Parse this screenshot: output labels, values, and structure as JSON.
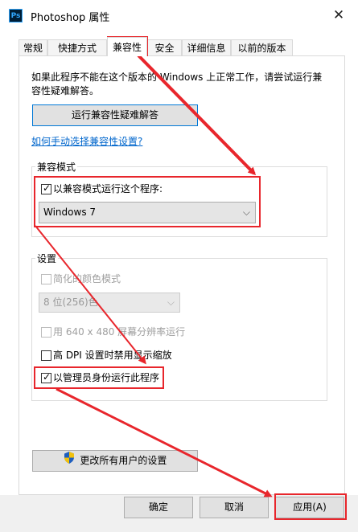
{
  "window": {
    "title": "Photoshop 属性",
    "icon_label": "Ps",
    "close_glyph": "✕"
  },
  "tabs": [
    {
      "label": "常规",
      "active": false
    },
    {
      "label": "快捷方式",
      "active": false
    },
    {
      "label": "兼容性",
      "active": true
    },
    {
      "label": "安全",
      "active": false
    },
    {
      "label": "详细信息",
      "active": false
    },
    {
      "label": "以前的版本",
      "active": false
    }
  ],
  "compat": {
    "intro_line1": "如果此程序不能在这个版本的 Windows 上正常工作，请尝试运行兼",
    "intro_line2": "容性疑难解答。",
    "troubleshooter_button": "运行兼容性疑难解答",
    "manual_link": "如何手动选择兼容性设置?",
    "mode_group_label": "兼容模式",
    "mode_checkbox_label": "以兼容模式运行这个程序:",
    "mode_checked": true,
    "mode_selected": "Windows 7",
    "settings_group_label": "设置",
    "reduced_color_label": "简化的颜色模式",
    "color_depth_selected": "8 位(256)色",
    "res_640_label": "用 640 x 480 屏幕分辨率运行",
    "high_dpi_label": "高 DPI 设置时禁用显示缩放",
    "admin_label": "以管理员身份运行此程序",
    "admin_checked": true,
    "all_users_button": "更改所有用户的设置"
  },
  "footer": {
    "ok": "确定",
    "cancel": "取消",
    "apply": "应用(A)"
  },
  "colors": {
    "annotation_red": "#e8262c",
    "link_blue": "#0066cc",
    "focus_blue": "#0078d7"
  },
  "icons": {
    "shield": "uac-shield-icon",
    "dropdown": "chevron-down-icon",
    "check": "checkmark-icon"
  }
}
